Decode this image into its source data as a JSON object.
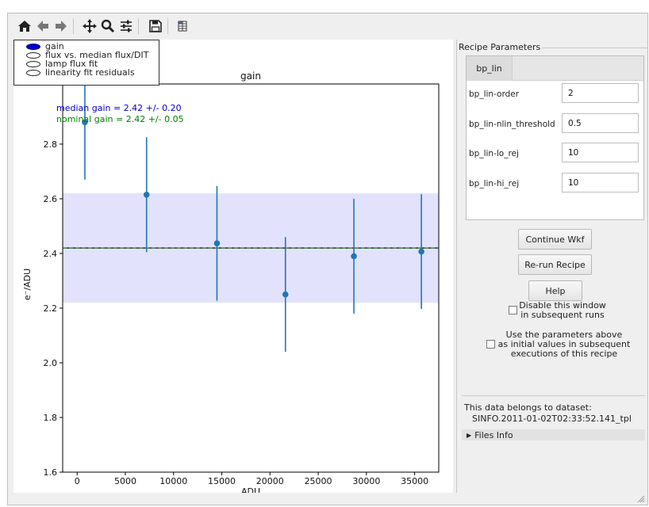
{
  "toolbar": {
    "icons": [
      "home-icon",
      "back-arrow-icon",
      "forward-arrow-icon",
      "pan-icon",
      "zoom-icon",
      "configure-icon",
      "save-icon",
      "grid-icon"
    ]
  },
  "legend": {
    "entries": [
      "gain",
      "flux vs. median flux/DIT",
      "lamp flux fit",
      "linearity fit residuals"
    ]
  },
  "chart_data": {
    "type": "scatter",
    "title": "gain",
    "xlabel": "ADU",
    "ylabel": "e⁻/ADU",
    "xlim": [
      -1500,
      37500
    ],
    "ylim": [
      1.6,
      3.02
    ],
    "xticks": [
      0,
      5000,
      10000,
      15000,
      20000,
      25000,
      30000,
      35000
    ],
    "yticks": [
      1.6,
      1.8,
      2.0,
      2.2,
      2.4,
      2.6,
      2.8
    ],
    "ytick_labels": [
      "1.6",
      "1.8",
      "2.0",
      "2.2",
      "2.4",
      "2.6",
      "2.8"
    ],
    "grid": false,
    "points": [
      {
        "x": 800,
        "y": 2.88,
        "err": 0.21
      },
      {
        "x": 7200,
        "y": 2.615,
        "err": 0.21
      },
      {
        "x": 14500,
        "y": 2.437,
        "err": 0.21
      },
      {
        "x": 21600,
        "y": 2.25,
        "err": 0.21
      },
      {
        "x": 28700,
        "y": 2.39,
        "err": 0.21
      },
      {
        "x": 35700,
        "y": 2.407,
        "err": 0.21
      }
    ],
    "median_gain": 2.42,
    "nominal_gain": 2.42,
    "band": [
      2.22,
      2.62
    ],
    "annotations": [
      {
        "text": "median gain  = 2.42 +/- 0.20",
        "color": "#0000cc"
      },
      {
        "text": "nominal gain = 2.42 +/- 0.05",
        "color": "#008000"
      }
    ],
    "colors": {
      "points": "#1f77b4",
      "band": "#e2e2fc",
      "median_line": "#1a1a1a",
      "nominal_line": "#2ca02c"
    }
  },
  "recipe": {
    "group_title": "Recipe Parameters",
    "tab_label": "bp_lin",
    "params": [
      {
        "label": "bp_lin-order",
        "value": "2"
      },
      {
        "label": "bp_lin-nlin_threshold",
        "value": "0.5"
      },
      {
        "label": "bp_lin-lo_rej",
        "value": "10"
      },
      {
        "label": "bp_lin-hi_rej",
        "value": "10"
      }
    ],
    "buttons": {
      "continue": "Continue Wkf",
      "rerun": "Re-run Recipe",
      "help": "Help"
    },
    "disable_line1": "Disable this window",
    "disable_line2": "in subsequent runs",
    "use_line1": "Use the parameters above",
    "use_line2": "as initial values in subsequent",
    "use_line3": "executions of this recipe",
    "dataset_label": "This data belongs to dataset:",
    "dataset_id": "SINFO.2011-01-02T02:33:52.141_tpl",
    "files_info": "Files Info"
  }
}
